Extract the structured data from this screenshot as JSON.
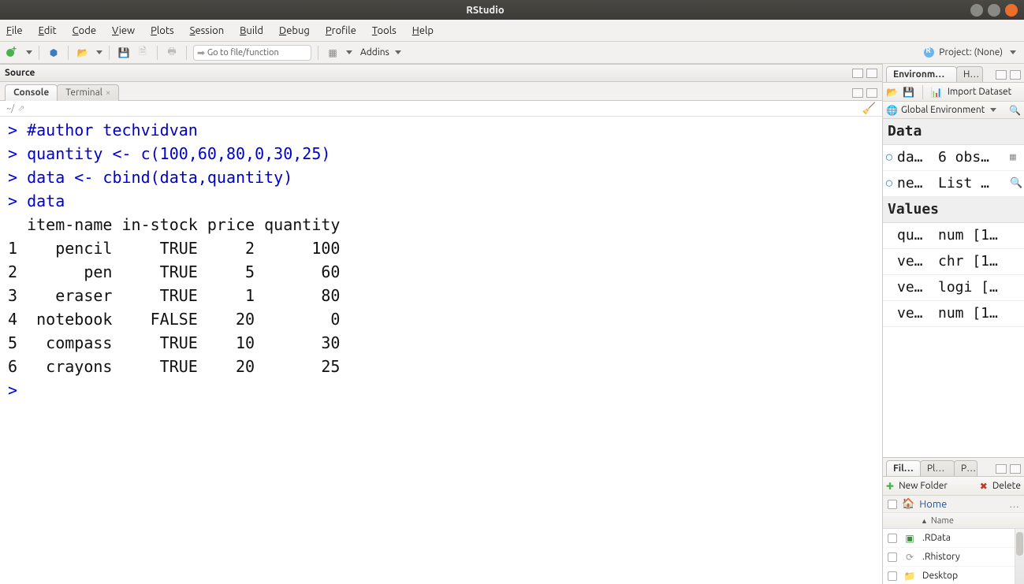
{
  "window": {
    "title": "RStudio"
  },
  "menu": {
    "file": "File",
    "edit": "Edit",
    "code": "Code",
    "view": "View",
    "plots": "Plots",
    "session": "Session",
    "build": "Build",
    "debug": "Debug",
    "profile": "Profile",
    "tools": "Tools",
    "help": "Help"
  },
  "toolbar": {
    "goto_placeholder": "Go to file/function",
    "addins": "Addins",
    "project_label": "Project: (None)"
  },
  "panes": {
    "source": "Source",
    "console": "Console",
    "terminal": "Terminal",
    "console_path": "~/",
    "env": "Environment",
    "history": "History",
    "import": "Import Dataset",
    "global_env": "Global Environment",
    "files": "Files",
    "plots_tab": "Plots",
    "packages": "Packages",
    "new_folder": "New Folder",
    "delete": "Delete",
    "home": "Home",
    "name_col": "Name"
  },
  "console_lines": [
    {
      "t": "in",
      "text": "#author techvidvan"
    },
    {
      "t": "in",
      "text": "quantity <- c(100,60,80,0,30,25)"
    },
    {
      "t": "in",
      "text": "data <- cbind(data,quantity)"
    },
    {
      "t": "in",
      "text": "data"
    },
    {
      "t": "out",
      "text": "  item-name in-stock price quantity"
    },
    {
      "t": "out",
      "text": "1    pencil     TRUE     2      100"
    },
    {
      "t": "out",
      "text": "2       pen     TRUE     5       60"
    },
    {
      "t": "out",
      "text": "3    eraser     TRUE     1       80"
    },
    {
      "t": "out",
      "text": "4  notebook    FALSE    20        0"
    },
    {
      "t": "out",
      "text": "5   compass     TRUE    10       30"
    },
    {
      "t": "out",
      "text": "6   crayons     TRUE    20       25"
    },
    {
      "t": "prompt",
      "text": ""
    }
  ],
  "env": {
    "data_label": "Data",
    "values_label": "Values",
    "data_items": [
      {
        "name": "da…",
        "value": "6 obs…",
        "expand": true,
        "grid": true
      },
      {
        "name": "ne…",
        "value": "List …",
        "expand": true,
        "search": true
      }
    ],
    "value_items": [
      {
        "name": "qu…",
        "value": "num [1…"
      },
      {
        "name": "ve…",
        "value": "chr [1…"
      },
      {
        "name": "ve…",
        "value": "logi […"
      },
      {
        "name": "ve…",
        "value": "num [1…"
      }
    ]
  },
  "files": {
    "items": [
      {
        "icon": "rdata",
        "name": ".RData"
      },
      {
        "icon": "rhist",
        "name": ".Rhistory"
      },
      {
        "icon": "folder",
        "name": "Desktop"
      }
    ]
  }
}
